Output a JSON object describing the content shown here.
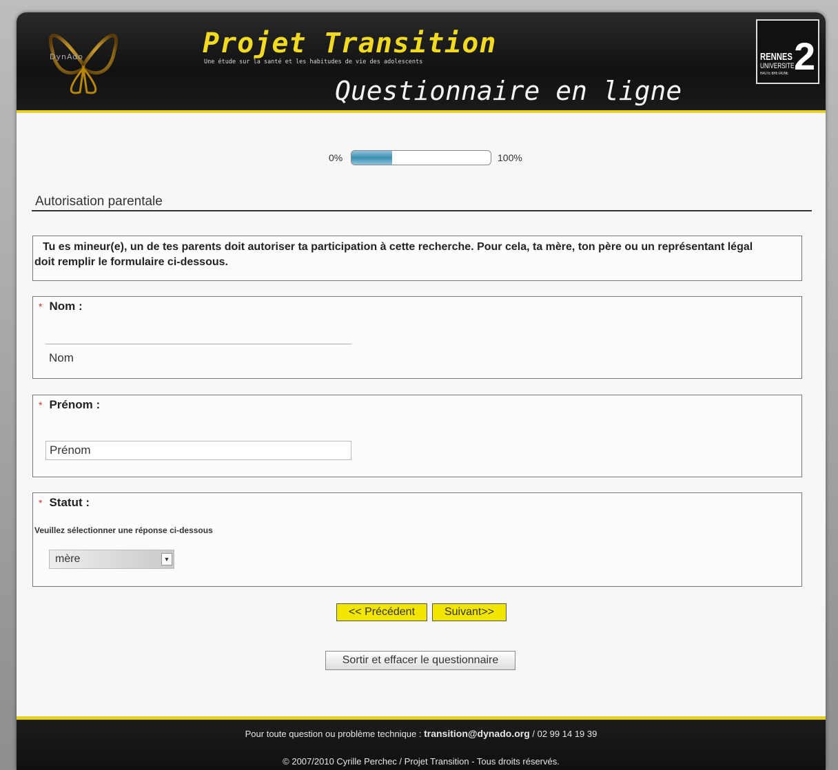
{
  "header": {
    "logo_text": "DynAdo",
    "title": "Projet Transition",
    "subtitle": "Une étude sur la santé et les habitudes de vie des adolescents",
    "questionnaire_title": "Questionnaire en ligne",
    "university": {
      "line1": "RENNES",
      "line2": "UNIVERSITE",
      "line3": "HAUTE BRETAGNE",
      "number": "2"
    }
  },
  "progress": {
    "start_label": "0%",
    "end_label": "100%",
    "value_percent": 29
  },
  "section": {
    "title": "Autorisation parentale"
  },
  "intro": {
    "text": "Tu es mineur(e), un de tes parents doit autoriser ta participation à cette recherche. Pour cela, ta mère, ton père ou un représentant légal doit remplir le formulaire ci-dessous."
  },
  "questions": {
    "nom": {
      "required_mark": "*",
      "label": "Nom :",
      "value": "Nom"
    },
    "prenom": {
      "required_mark": "*",
      "label": "Prénom :",
      "value": "Prénom"
    },
    "statut": {
      "required_mark": "*",
      "label": "Statut :",
      "hint": "Veuillez sélectionner une réponse ci-dessous",
      "selected": "mère",
      "arrow": "▼"
    }
  },
  "buttons": {
    "previous": "<< Précédent",
    "next": "Suivant>>",
    "exit": "Sortir et effacer le questionnaire"
  },
  "footer": {
    "line1_prefix": "Pour toute question ou problème technique : ",
    "email": "transition@dynado.org",
    "line1_suffix": " / 02 99 14 19 39",
    "line2": "© 2007/2010 Cyrille Perchec / Projet Transition - Tous droits réservés."
  },
  "colors": {
    "accent_yellow": "#f2e600",
    "header_bg": "#111111",
    "progress_fill": "#3c8fb3"
  }
}
